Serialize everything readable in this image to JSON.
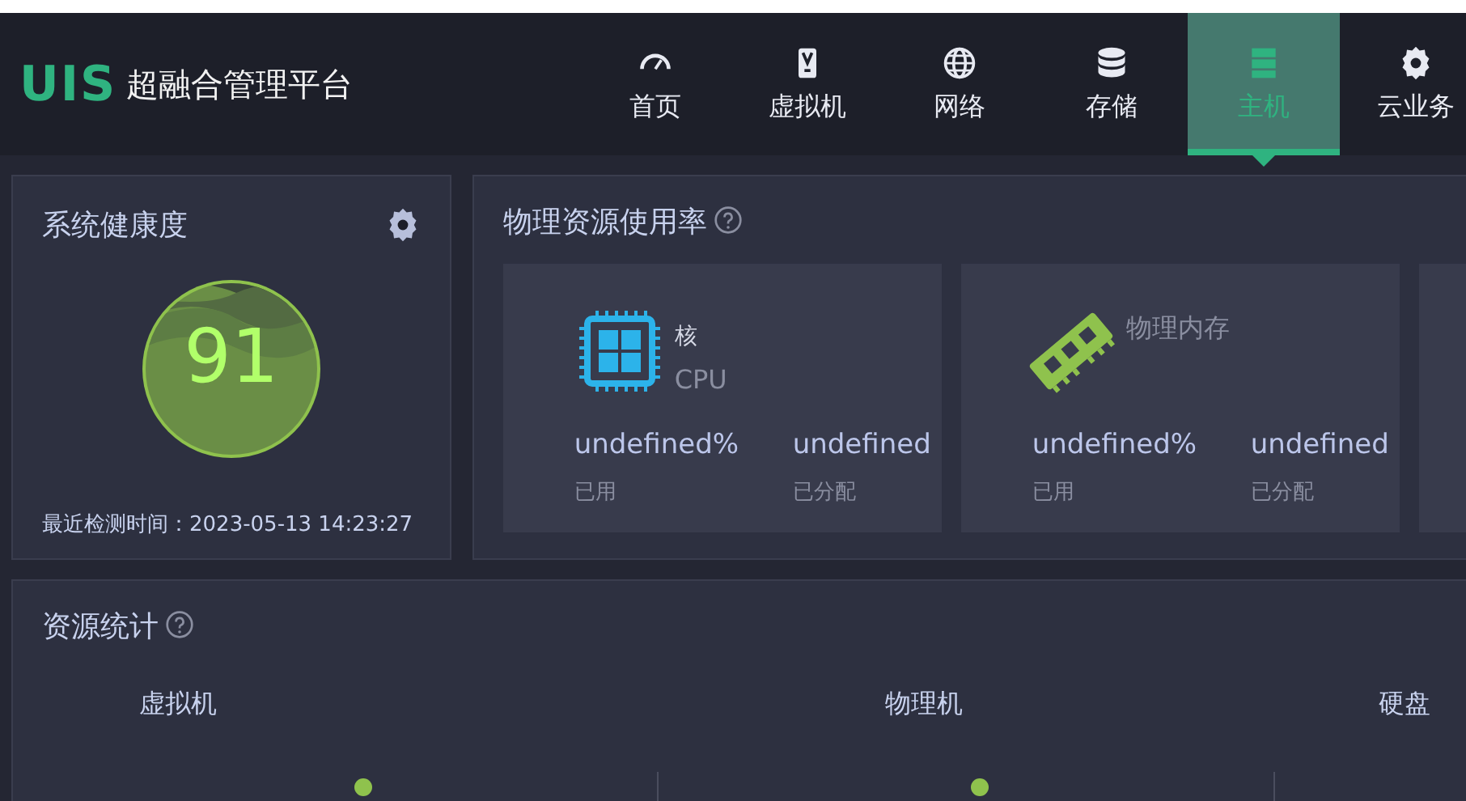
{
  "header": {
    "logo": "UIS",
    "title": "超融合管理平台",
    "nav": [
      {
        "label": "首页",
        "selected": false
      },
      {
        "label": "虚拟机",
        "selected": false
      },
      {
        "label": "网络",
        "selected": false
      },
      {
        "label": "存储",
        "selected": false
      },
      {
        "label": "主机",
        "selected": true
      },
      {
        "label": "云业务",
        "selected": false
      }
    ]
  },
  "health": {
    "title": "系统健康度",
    "score": "91",
    "last_check": "最近检测时间：2023-05-13 14:23:27"
  },
  "usage": {
    "title": "物理资源使用率",
    "cards": [
      {
        "kind": "cpu",
        "unit": "核",
        "name": "CPU",
        "used": "undefined%",
        "used_label": "已用",
        "allocated": "undefined",
        "allocated_label": "已分配"
      },
      {
        "kind": "memory",
        "name": "物理内存",
        "used": "undefined%",
        "used_label": "已用",
        "allocated": "undefined",
        "allocated_label": "已分配"
      }
    ]
  },
  "stats": {
    "title": "资源统计",
    "columns": [
      "虚拟机",
      "物理机",
      "硬盘"
    ]
  }
}
